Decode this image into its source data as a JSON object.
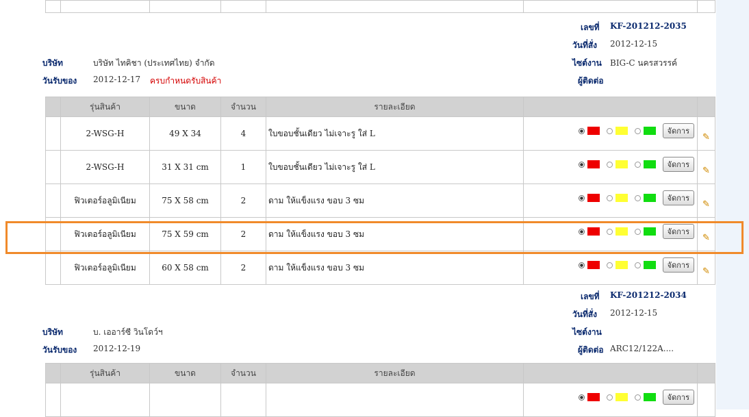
{
  "orders": [
    {
      "doc_no_label": "เลขที่",
      "doc_no": "KF-201212-2035",
      "order_date_label": "วันที่สั่ง",
      "order_date": "2012-12-15",
      "company_label": "บริษัท",
      "company": "บริษัท ไทคิชา (ประเทศไทย) จำกัด",
      "site_label": "ไซต์งาน",
      "site": "BIG-C นครสวรรค์",
      "receive_label": "วันรับของ",
      "receive_date": "2012-12-17",
      "receive_note": "ครบกำหนดรับสินค้า",
      "contact_label": "ผู้ติดต่อ",
      "contact": ""
    },
    {
      "doc_no_label": "เลขที่",
      "doc_no": "KF-201212-2034",
      "order_date_label": "วันที่สั่ง",
      "order_date": "2012-12-15",
      "company_label": "บริษัท",
      "company": "บ. เออาร์ซี วินโดว์ฯ",
      "site_label": "ไซต์งาน",
      "site": "",
      "receive_label": "วันรับของ",
      "receive_date": "2012-12-19",
      "receive_note": "",
      "contact_label": "ผู้ติดต่อ",
      "contact": "ARC12/122A...."
    }
  ],
  "columns": [
    "รุ่นสินค้า",
    "ขนาด",
    "จำนวน",
    "รายละเอียด"
  ],
  "rows": [
    {
      "model": "2-WSG-H",
      "size": "49 X 34",
      "qty": "4",
      "detail": "ใบขอบชั้นเดียว ไม่เจาะรู ใส่ L"
    },
    {
      "model": "2-WSG-H",
      "size": "31 X 31 cm",
      "qty": "1",
      "detail": "ใบขอบชั้นเดียว ไม่เจาะรู ใส่ L"
    },
    {
      "model": "ฟิวเตอร์อลูมิเนียม",
      "size": "75 X 58 cm",
      "qty": "2",
      "detail": "ดาม ให้แข็งแรง ขอบ 3 ซม"
    },
    {
      "model": "ฟิวเตอร์อลูมิเนียม",
      "size": "75 X 59 cm",
      "qty": "2",
      "detail": "ดาม ให้แข็งแรง ขอบ 3 ซม"
    },
    {
      "model": "ฟิวเตอร์อลูมิเนียม",
      "size": "60 X 58 cm",
      "qty": "2",
      "detail": "ดาม ให้แข็งแรง ขอบ 3 ซม"
    }
  ],
  "manage_label": "จัดการ",
  "status_colors": [
    "#ee0000",
    "#ffff33",
    "#11dd11"
  ],
  "highlight_color": "#f08a2a"
}
